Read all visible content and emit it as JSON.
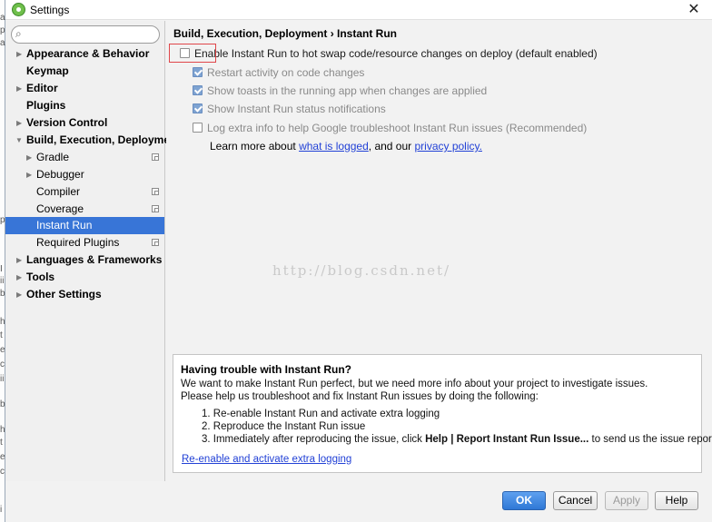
{
  "window": {
    "title": "Settings",
    "close_glyph": "✕"
  },
  "sidebar": {
    "search_placeholder": "",
    "search_icon": "magnifier-icon",
    "items": [
      {
        "label": "Appearance & Behavior",
        "arrow": "▶",
        "bold": true
      },
      {
        "label": "Keymap",
        "arrow": "",
        "bold": true
      },
      {
        "label": "Editor",
        "arrow": "▶",
        "bold": true
      },
      {
        "label": "Plugins",
        "arrow": "",
        "bold": true
      },
      {
        "label": "Version Control",
        "arrow": "▶",
        "bold": true
      },
      {
        "label": "Build, Execution, Deployment",
        "arrow": "▼",
        "bold": true
      },
      {
        "label": "Gradle",
        "arrow": "▶",
        "bold": false
      },
      {
        "label": "Debugger",
        "arrow": "▶",
        "bold": false
      },
      {
        "label": "Compiler",
        "arrow": "",
        "bold": false
      },
      {
        "label": "Coverage",
        "arrow": "",
        "bold": false
      },
      {
        "label": "Instant Run",
        "arrow": "",
        "bold": false,
        "selected": true
      },
      {
        "label": "Required Plugins",
        "arrow": "",
        "bold": false
      },
      {
        "label": "Languages & Frameworks",
        "arrow": "▶",
        "bold": true
      },
      {
        "label": "Tools",
        "arrow": "▶",
        "bold": true
      },
      {
        "label": "Other Settings",
        "arrow": "▶",
        "bold": true
      }
    ]
  },
  "content": {
    "breadcrumb": "Build, Execution, Deployment › Instant Run",
    "options": [
      {
        "label": "Enable Instant Run to hot swap code/resource changes on deploy (default enabled)",
        "checked": false,
        "disabled": false
      },
      {
        "label": "Restart activity on code changes",
        "checked": true,
        "disabled": true
      },
      {
        "label": "Show toasts in the running app when changes are applied",
        "checked": true,
        "disabled": true
      },
      {
        "label": "Show Instant Run status notifications",
        "checked": true,
        "disabled": true
      },
      {
        "label": "Log extra info to help Google troubleshoot Instant Run issues (Recommended)",
        "checked": false,
        "disabled": true
      }
    ],
    "learn_more": {
      "prefix": "Learn more about ",
      "link1": "what is logged",
      "middle": ", and our ",
      "link2": "privacy policy."
    },
    "watermark": "http://blog.csdn.net/"
  },
  "trouble": {
    "title": "Having trouble with Instant Run?",
    "line1": "We want to make Instant Run perfect, but we need more info about your project to investigate issues.",
    "line2": "Please help us troubleshoot and fix Instant Run issues by doing the following:",
    "step1": "1. Re-enable Instant Run and activate extra logging",
    "step2": "2. Reproduce the Instant Run issue",
    "step3_prefix": "3. Immediately after reproducing the issue, click ",
    "step3_bold": "Help | Report Instant Run Issue...",
    "step3_suffix": " to send us the issue report.",
    "link": "Re-enable and activate extra logging"
  },
  "footer": {
    "ok": "OK",
    "cancel": "Cancel",
    "apply": "Apply",
    "help": "Help"
  },
  "colors": {
    "selection": "#3875d7",
    "link": "#2241d6",
    "ok_button": "#2f78d6",
    "highlight_box": "#e0464a"
  },
  "background_chars": [
    "a",
    "p",
    "a",
    "p",
    "I",
    "ii",
    "b",
    "h",
    "t",
    "e",
    "c",
    "ii",
    "b",
    "h",
    "t",
    "e",
    "c",
    "i"
  ]
}
